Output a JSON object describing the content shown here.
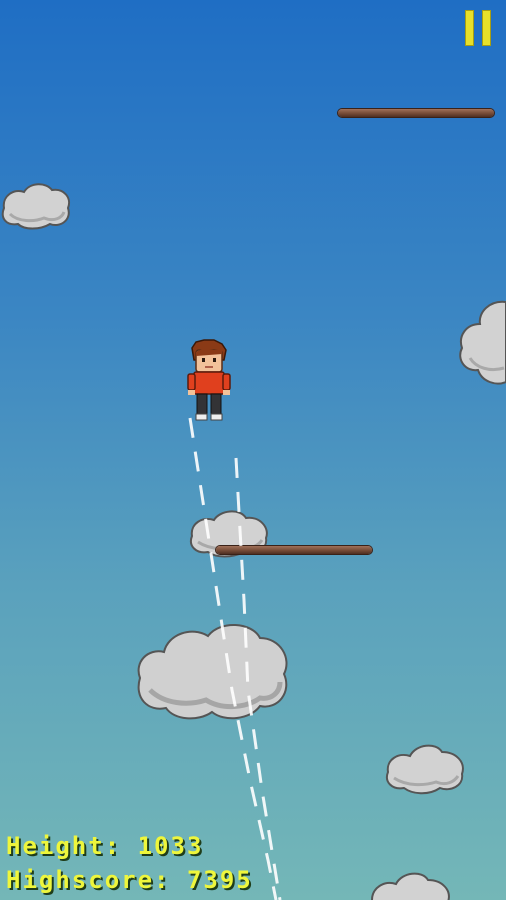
{
  "hud": {
    "height_label": "Height:",
    "height_value": "1033",
    "highscore_label": "Highscore:",
    "highscore_value": "7395"
  },
  "controls": {
    "pause_icon": "pause-icon"
  },
  "colors": {
    "sky_top": "#1f6ec4",
    "sky_bottom": "#74b7b7",
    "hud_text": "#eef63c",
    "pause": "#e7e02a",
    "platform": "#7a4f3a",
    "cloud": "#cfcfcf",
    "player_shirt": "#e0401e"
  }
}
